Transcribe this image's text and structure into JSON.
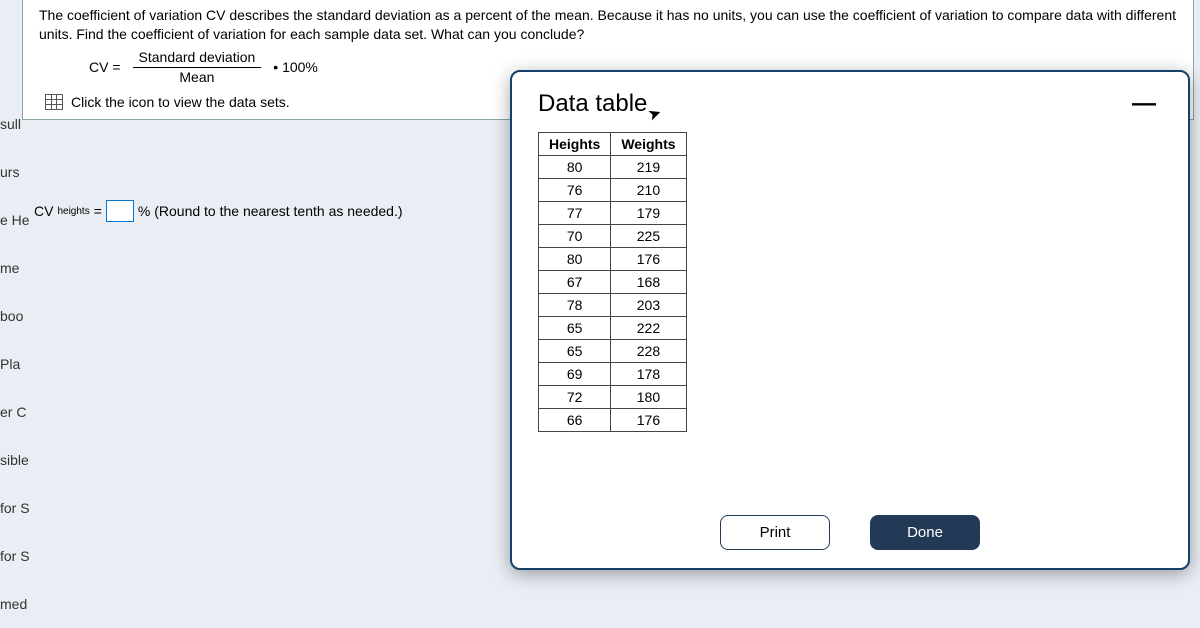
{
  "sidebar_fragments": [
    "sull",
    "urs",
    "e He",
    "me",
    "boo",
    "Pla",
    "er C",
    "sible",
    "for S",
    "for S",
    "med"
  ],
  "question": {
    "text": "The coefficient of variation CV describes the standard deviation as a percent of the mean. Because it has no units, you can use the coefficient of variation to compare data with different units. Find the coefficient of variation for each sample data set. What can you conclude?",
    "formula_lhs": "CV =",
    "formula_top": "Standard deviation",
    "formula_bot": "Mean",
    "formula_rhs": "• 100%",
    "click_text": "Click the icon to view the data sets."
  },
  "cv_input": {
    "prefix": "CV",
    "subscript": "heights",
    "equals": "=",
    "suffix": "% (Round to the nearest tenth as needed.)"
  },
  "modal": {
    "title": "Data table",
    "print_label": "Print",
    "done_label": "Done",
    "columns": [
      "Heights",
      "Weights"
    ],
    "rows": [
      [
        80,
        219
      ],
      [
        76,
        210
      ],
      [
        77,
        179
      ],
      [
        70,
        225
      ],
      [
        80,
        176
      ],
      [
        67,
        168
      ],
      [
        78,
        203
      ],
      [
        65,
        222
      ],
      [
        65,
        228
      ],
      [
        69,
        178
      ],
      [
        72,
        180
      ],
      [
        66,
        176
      ]
    ]
  },
  "chart_data": {
    "type": "table",
    "title": "Data table",
    "columns": [
      "Heights",
      "Weights"
    ],
    "rows": [
      [
        80,
        219
      ],
      [
        76,
        210
      ],
      [
        77,
        179
      ],
      [
        70,
        225
      ],
      [
        80,
        176
      ],
      [
        67,
        168
      ],
      [
        78,
        203
      ],
      [
        65,
        222
      ],
      [
        65,
        228
      ],
      [
        69,
        178
      ],
      [
        72,
        180
      ],
      [
        66,
        176
      ]
    ]
  }
}
